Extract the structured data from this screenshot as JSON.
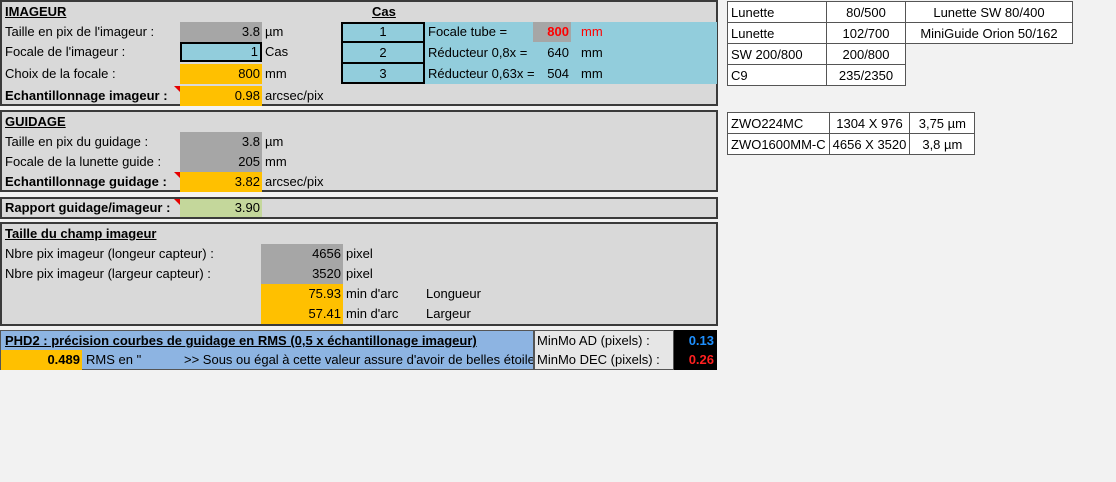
{
  "imageur": {
    "title": "IMAGEUR",
    "rows": [
      {
        "label": "Taille en pix de l'imageur :",
        "value": "3.8",
        "unit": "µm"
      },
      {
        "label": "Focale de l'imageur :",
        "value": "1",
        "unit": "Cas"
      },
      {
        "label": "Choix de la focale :",
        "value": "800",
        "unit": "mm"
      },
      {
        "label": "Echantillonnage imageur :",
        "value": "0.98",
        "unit": "arcsec/pix"
      }
    ],
    "cas": {
      "title": "Cas",
      "items": [
        {
          "num": "1",
          "label": "Focale tube =",
          "value": "800",
          "unit": "mm"
        },
        {
          "num": "2",
          "label": "Réducteur 0,8x =",
          "value": "640",
          "unit": "mm"
        },
        {
          "num": "3",
          "label": "Réducteur 0,63x =",
          "value": "504",
          "unit": "mm"
        }
      ]
    }
  },
  "guidage": {
    "title": "GUIDAGE",
    "rows": [
      {
        "label": "Taille en pix du guidage :",
        "value": "3.8",
        "unit": "µm"
      },
      {
        "label": "Focale de la lunette guide :",
        "value": "205",
        "unit": "mm"
      },
      {
        "label": "Echantillonnage guidage :",
        "value": "3.82",
        "unit": "arcsec/pix"
      }
    ]
  },
  "rapport": {
    "label": "Rapport guidage/imageur :",
    "value": "3.90"
  },
  "champ": {
    "title": "Taille du champ imageur",
    "rows": [
      {
        "label": "Nbre pix imageur (longeur capteur) :",
        "value": "4656",
        "unit": "pixel"
      },
      {
        "label": "Nbre pix imageur (largeur capteur) :",
        "value": "3520",
        "unit": "pixel"
      },
      {
        "label": "",
        "value": "75.93",
        "unit": "min d'arc",
        "extra": "Longueur"
      },
      {
        "label": "",
        "value": "57.41",
        "unit": "min d'arc",
        "extra": "Largeur"
      }
    ]
  },
  "phd2": {
    "title": "PHD2 : précision courbes de guidage en RMS (0,5 x échantillonage imageur)",
    "value": "0.489",
    "unit": "RMS en \"",
    "note": ">> Sous ou égal à cette valeur assure d'avoir de belles étoiles",
    "minmo_ad_label": "MinMo AD (pixels) :",
    "minmo_ad_value": "0.13",
    "minmo_dec_label": "MinMo DEC (pixels) :",
    "minmo_dec_value": "0.26"
  },
  "scopes": [
    [
      "Lunette",
      "80/500",
      "Lunette SW 80/400"
    ],
    [
      "Lunette",
      "102/700",
      "MiniGuide Orion 50/162"
    ],
    [
      "SW 200/800",
      "200/800",
      ""
    ],
    [
      "C9",
      "235/2350",
      ""
    ]
  ],
  "cameras": [
    [
      "ZWO224MC",
      "1304 X 976",
      "3,75 µm"
    ],
    [
      "ZWO1600MM-C",
      "4656 X 3520",
      "3,8 µm"
    ]
  ],
  "colors": {
    "red_value": "#ff0000",
    "ad_blue": "#1e90ff",
    "dec_red": "#ff2020"
  }
}
